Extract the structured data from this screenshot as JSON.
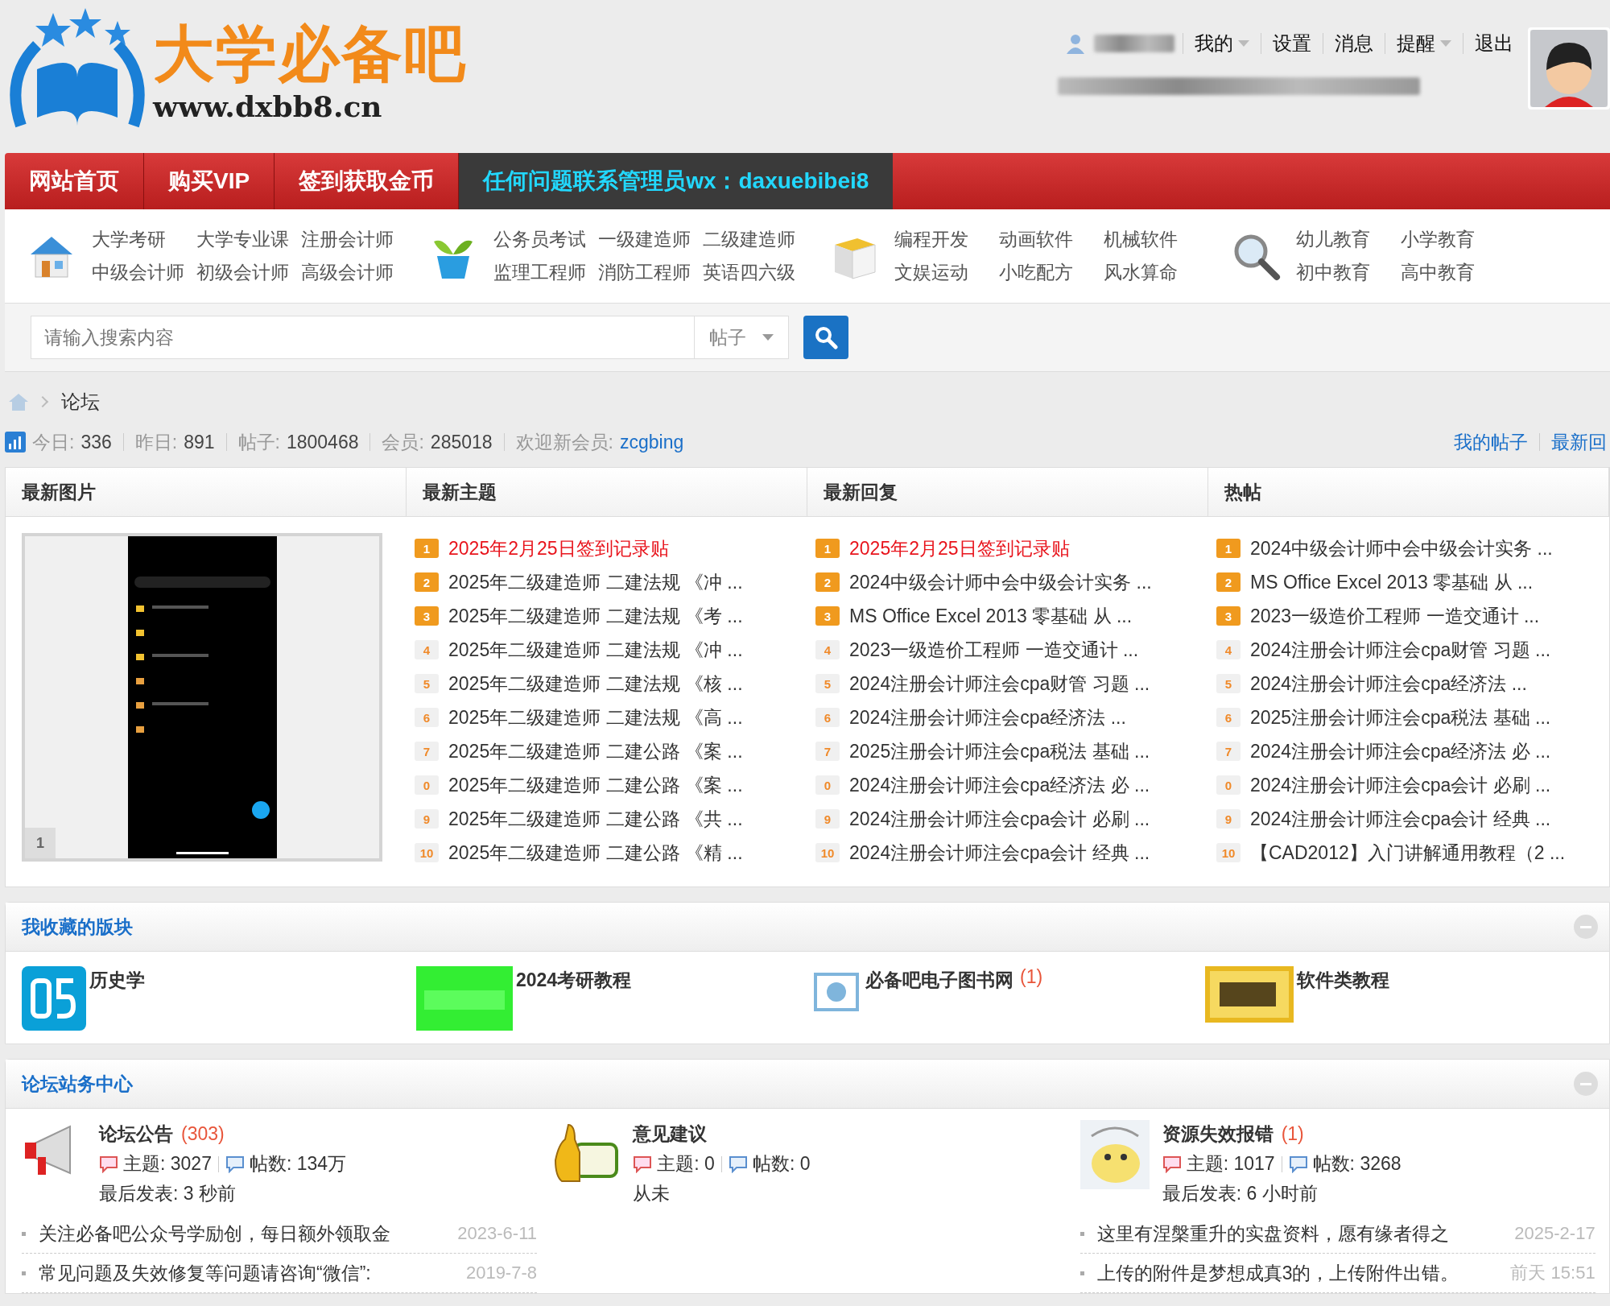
{
  "header": {
    "logo": {
      "title": "大学必备吧",
      "url": "www.dxbb8.cn"
    },
    "user_menu": [
      {
        "label": "我的",
        "dropdown": true
      },
      {
        "label": "设置",
        "dropdown": false
      },
      {
        "label": "消息",
        "dropdown": false
      },
      {
        "label": "提醒",
        "dropdown": true
      },
      {
        "label": "退出",
        "dropdown": false
      }
    ]
  },
  "nav": [
    {
      "label": "网站首页",
      "kind": "link"
    },
    {
      "label": "购买VIP",
      "kind": "link"
    },
    {
      "label": "签到获取金币",
      "kind": "link"
    },
    {
      "label": "任何问题联系管理员wx：daxuebibei8",
      "kind": "notice"
    }
  ],
  "categories": [
    {
      "rows": [
        [
          "大学考研",
          "大学专业课",
          "注册会计师"
        ],
        [
          "中级会计师",
          "初级会计师",
          "高级会计师"
        ]
      ]
    },
    {
      "rows": [
        [
          "公务员考试",
          "一级建造师",
          "二级建造师"
        ],
        [
          "监理工程师",
          "消防工程师",
          "英语四六级"
        ]
      ]
    },
    {
      "rows": [
        [
          "编程开发",
          "动画软件",
          "机械软件"
        ],
        [
          "文娱运动",
          "小吃配方",
          "风水算命"
        ]
      ]
    },
    {
      "rows": [
        [
          "幼儿教育",
          "小学教育"
        ],
        [
          "初中教育",
          "高中教育"
        ]
      ]
    }
  ],
  "search": {
    "placeholder": "请输入搜索内容",
    "scope": "帖子"
  },
  "breadcrumb": "论坛",
  "stats": [
    {
      "label": "今日:",
      "value": "336",
      "link": false
    },
    {
      "label": "昨日:",
      "value": "891",
      "link": false
    },
    {
      "label": "帖子:",
      "value": "1800468",
      "link": false
    },
    {
      "label": "会员:",
      "value": "285018",
      "link": false
    },
    {
      "label": "欢迎新会员:",
      "value": "zcgbing",
      "link": true
    }
  ],
  "stats_links": [
    "我的帖子",
    "最新回"
  ],
  "overview": {
    "columns": [
      "最新图片",
      "最新主题",
      "最新回复",
      "热帖"
    ],
    "slide_index": "1",
    "lists": [
      [
        {
          "rank": "1",
          "title": "2025年2月25日签到记录贴",
          "top": true,
          "highlight": true
        },
        {
          "rank": "2",
          "title": "2025年二级建造师 二建法规 《冲 ...",
          "top": true,
          "highlight": false
        },
        {
          "rank": "3",
          "title": "2025年二级建造师 二建法规 《考 ...",
          "top": true,
          "highlight": false
        },
        {
          "rank": "4",
          "title": "2025年二级建造师 二建法规 《冲 ...",
          "top": false,
          "highlight": false
        },
        {
          "rank": "5",
          "title": "2025年二级建造师 二建法规 《核 ...",
          "top": false,
          "highlight": false
        },
        {
          "rank": "6",
          "title": "2025年二级建造师 二建法规 《高 ...",
          "top": false,
          "highlight": false
        },
        {
          "rank": "7",
          "title": "2025年二级建造师 二建公路 《案 ...",
          "top": false,
          "highlight": false
        },
        {
          "rank": "0",
          "title": "2025年二级建造师 二建公路 《案 ...",
          "top": false,
          "highlight": false
        },
        {
          "rank": "9",
          "title": "2025年二级建造师 二建公路 《共 ...",
          "top": false,
          "highlight": false
        },
        {
          "rank": "10",
          "title": "2025年二级建造师 二建公路 《精 ...",
          "top": false,
          "highlight": false
        }
      ],
      [
        {
          "rank": "1",
          "title": "2025年2月25日签到记录贴",
          "top": true,
          "highlight": true
        },
        {
          "rank": "2",
          "title": "2024中级会计师中会中级会计实务 ...",
          "top": true,
          "highlight": false
        },
        {
          "rank": "3",
          "title": "MS Office Excel 2013 零基础 从 ...",
          "top": true,
          "highlight": false
        },
        {
          "rank": "4",
          "title": "2023一级造价工程师 一造交通计 ...",
          "top": false,
          "highlight": false
        },
        {
          "rank": "5",
          "title": "2024注册会计师注会cpa财管 习题 ...",
          "top": false,
          "highlight": false
        },
        {
          "rank": "6",
          "title": "2024注册会计师注会cpa经济法 ...",
          "top": false,
          "highlight": false
        },
        {
          "rank": "7",
          "title": "2025注册会计师注会cpa税法 基础 ...",
          "top": false,
          "highlight": false
        },
        {
          "rank": "0",
          "title": "2024注册会计师注会cpa经济法 必 ...",
          "top": false,
          "highlight": false
        },
        {
          "rank": "9",
          "title": "2024注册会计师注会cpa会计 必刷 ...",
          "top": false,
          "highlight": false
        },
        {
          "rank": "10",
          "title": "2024注册会计师注会cpa会计 经典 ...",
          "top": false,
          "highlight": false
        }
      ],
      [
        {
          "rank": "1",
          "title": "2024中级会计师中会中级会计实务 ...",
          "top": true,
          "highlight": false
        },
        {
          "rank": "2",
          "title": "MS Office Excel 2013 零基础 从 ...",
          "top": true,
          "highlight": false
        },
        {
          "rank": "3",
          "title": "2023一级造价工程师 一造交通计 ...",
          "top": true,
          "highlight": false
        },
        {
          "rank": "4",
          "title": "2024注册会计师注会cpa财管 习题 ...",
          "top": false,
          "highlight": false
        },
        {
          "rank": "5",
          "title": "2024注册会计师注会cpa经济法 ...",
          "top": false,
          "highlight": false
        },
        {
          "rank": "6",
          "title": "2025注册会计师注会cpa税法 基础 ...",
          "top": false,
          "highlight": false
        },
        {
          "rank": "7",
          "title": "2024注册会计师注会cpa经济法 必 ...",
          "top": false,
          "highlight": false
        },
        {
          "rank": "0",
          "title": "2024注册会计师注会cpa会计 必刷 ...",
          "top": false,
          "highlight": false
        },
        {
          "rank": "9",
          "title": "2024注册会计师注会cpa会计 经典 ...",
          "top": false,
          "highlight": false
        },
        {
          "rank": "10",
          "title": "【CAD2012】入门讲解通用教程（2 ...",
          "top": false,
          "highlight": false
        }
      ]
    ]
  },
  "favorites": {
    "title": "我收藏的版块",
    "items": [
      {
        "name": "历史学"
      },
      {
        "name": "2024考研教程"
      },
      {
        "name": "必备吧电子图书网",
        "count": "(1)"
      },
      {
        "name": "软件类教程"
      }
    ]
  },
  "site_center": {
    "title": "论坛站务中心",
    "forums": [
      {
        "name": "论坛公告",
        "count": "(303)",
        "topics": "主题: 3027",
        "posts": "帖数: 134万",
        "last": "最后发表: 3 秒前",
        "threads": [
          {
            "title": "关注必备吧公众号学励创，每日额外领取金",
            "date": "2023-6-11"
          },
          {
            "title": "常见问题及失效修复等问题请咨询“微信”:",
            "date": "2019-7-8"
          }
        ]
      },
      {
        "name": "意见建议",
        "topics": "主题: 0",
        "posts": "帖数: 0",
        "last": "从未"
      },
      {
        "name": "资源失效报错",
        "count": "(1)",
        "topics": "主题: 1017",
        "posts": "帖数: 3268",
        "last": "最后发表: 6 小时前",
        "threads": [
          {
            "title": "这里有涅槃重升的实盘资料，愿有缘者得之",
            "date": "2025-2-17"
          },
          {
            "title": "上传的附件是梦想成真3的，上传附件出错。",
            "date": "前天 15:51"
          }
        ]
      }
    ]
  }
}
